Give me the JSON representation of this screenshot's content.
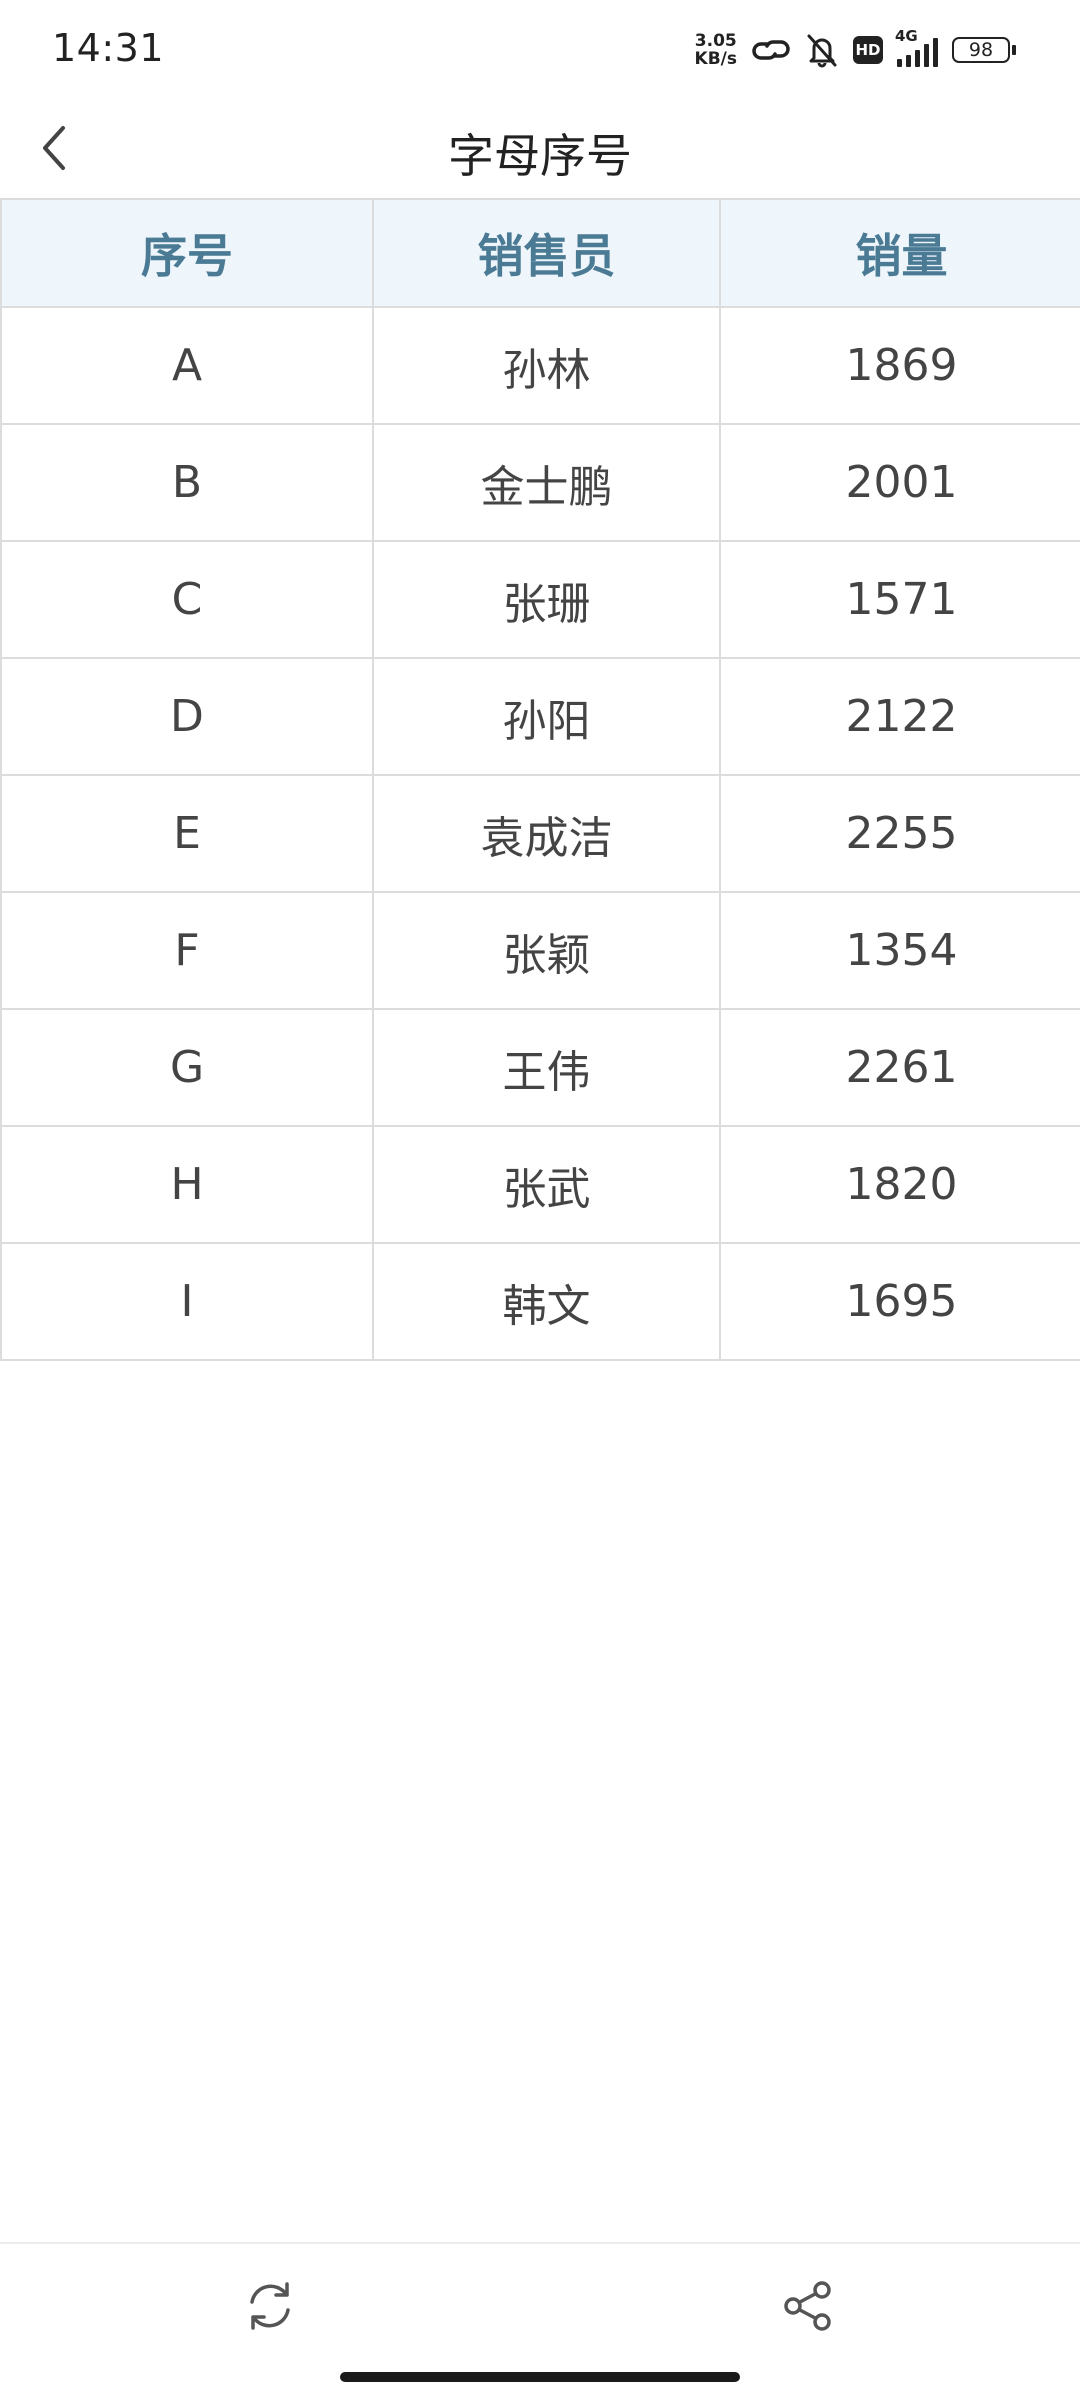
{
  "status_bar": {
    "time": "14:31",
    "net_speed_value": "3.05",
    "net_speed_unit": "KB/s",
    "network_type": "4G",
    "hd_label": "HD",
    "battery": "98",
    "icons": [
      "link-icon",
      "bell-off-icon",
      "hd-icon",
      "signal-icon",
      "battery-icon"
    ]
  },
  "header": {
    "title": "字母序号",
    "back_icon": "chevron-left-icon"
  },
  "table": {
    "columns": [
      "序号",
      "销售员",
      "销量"
    ],
    "rows": [
      [
        "A",
        "孙林",
        "1869"
      ],
      [
        "B",
        "金士鹏",
        "2001"
      ],
      [
        "C",
        "张珊",
        "1571"
      ],
      [
        "D",
        "孙阳",
        "2122"
      ],
      [
        "E",
        "袁成洁",
        "2255"
      ],
      [
        "F",
        "张颖",
        "1354"
      ],
      [
        "G",
        "王伟",
        "2261"
      ],
      [
        "H",
        "张武",
        "1820"
      ],
      [
        "I",
        "韩文",
        "1695"
      ]
    ]
  },
  "toolbar": {
    "refresh_icon": "refresh-icon",
    "share_icon": "share-icon"
  },
  "colors": {
    "header_bg": "#eef6fc",
    "header_text": "#4a7a94",
    "border": "#dcdcdc",
    "text": "#444444"
  }
}
